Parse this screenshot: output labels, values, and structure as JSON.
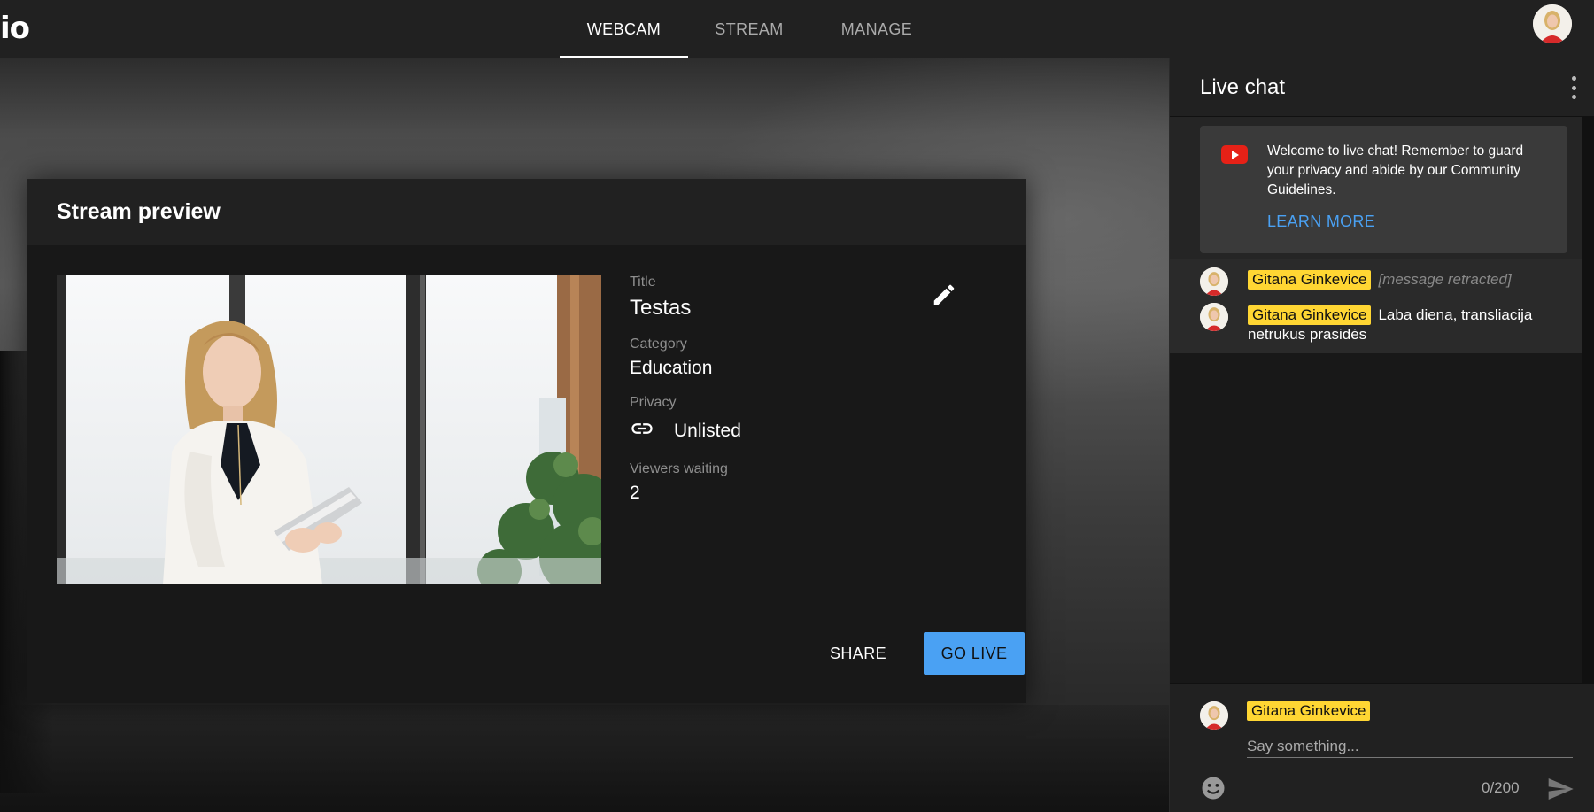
{
  "app": {
    "brand": "io"
  },
  "nav": {
    "tabs": [
      {
        "label": "WEBCAM",
        "active": true
      },
      {
        "label": "STREAM",
        "active": false
      },
      {
        "label": "MANAGE",
        "active": false
      }
    ]
  },
  "preview_card": {
    "title": "Stream preview",
    "fields": {
      "title_label": "Title",
      "title_value": "Testas",
      "category_label": "Category",
      "category_value": "Education",
      "privacy_label": "Privacy",
      "privacy_value": "Unlisted",
      "viewers_label": "Viewers waiting",
      "viewers_value": "2"
    },
    "share_label": "SHARE",
    "go_live_label": "GO LIVE",
    "icons": {
      "edit": "pencil-icon",
      "privacy": "link-icon"
    }
  },
  "chat": {
    "title": "Live chat",
    "welcome_text": "Welcome to live chat! Remember to guard your privacy and abide by our Community Guidelines.",
    "learn_more_label": "LEARN MORE",
    "messages": [
      {
        "author": "Gitana Ginkevice",
        "text": "[message retracted]",
        "retracted": true
      },
      {
        "author": "Gitana Ginkevice",
        "text": "Laba diena, transliacija netrukus prasidės",
        "retracted": false
      }
    ],
    "composer": {
      "author": "Gitana Ginkevice",
      "placeholder": "Say something...",
      "char_count": "0/200"
    }
  },
  "colors": {
    "accent_blue": "#4aa1f3",
    "name_badge": "#ffd633",
    "youtube_red": "#e62117"
  }
}
